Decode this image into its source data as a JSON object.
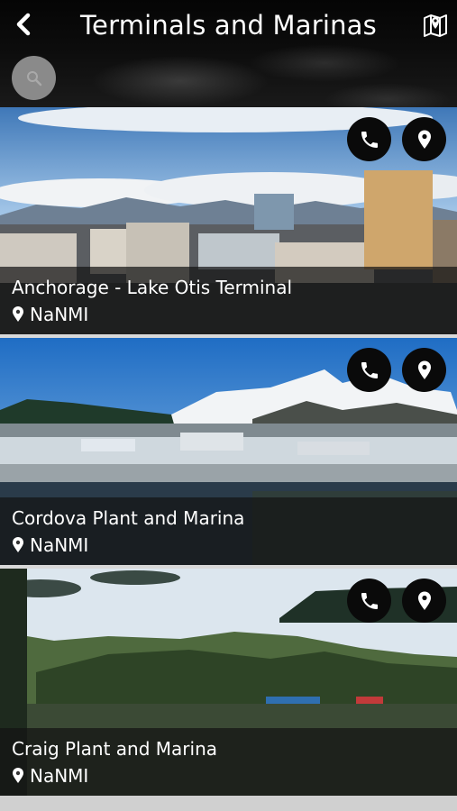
{
  "header": {
    "title": "Terminals and Marinas",
    "back_icon": "chevron-left-icon",
    "map_icon": "map-icon",
    "search_icon": "search-icon"
  },
  "cards": [
    {
      "name": "Anchorage - Lake Otis Terminal",
      "location": "NaNMI",
      "phone_icon": "phone-icon",
      "pin_icon": "map-pin-icon"
    },
    {
      "name": "Cordova Plant and Marina",
      "location": "NaNMI",
      "phone_icon": "phone-icon",
      "pin_icon": "map-pin-icon"
    },
    {
      "name": "Craig Plant and Marina",
      "location": "NaNMI",
      "phone_icon": "phone-icon",
      "pin_icon": "map-pin-icon"
    }
  ],
  "colors": {
    "header_bg": "#000000",
    "search_bg": "#8a8a8a",
    "overlay": "#141414",
    "text": "#ffffff"
  }
}
